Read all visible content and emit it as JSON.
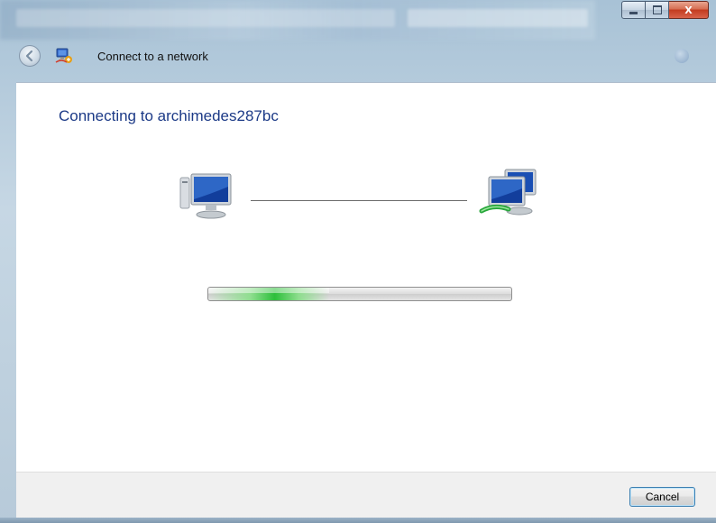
{
  "window": {
    "title": "Connect to a network",
    "caption_buttons": {
      "minimize_icon": "minimize-icon",
      "maximize_icon": "maximize-icon",
      "close_glyph": "X"
    }
  },
  "content": {
    "heading": "Connecting to archimedes287bc",
    "progress_fraction": 0.4
  },
  "footer": {
    "cancel_label": "Cancel"
  },
  "colors": {
    "heading": "#1c3a87",
    "progress_green": "#2dbf3b",
    "close_red": "#c23b1f"
  }
}
